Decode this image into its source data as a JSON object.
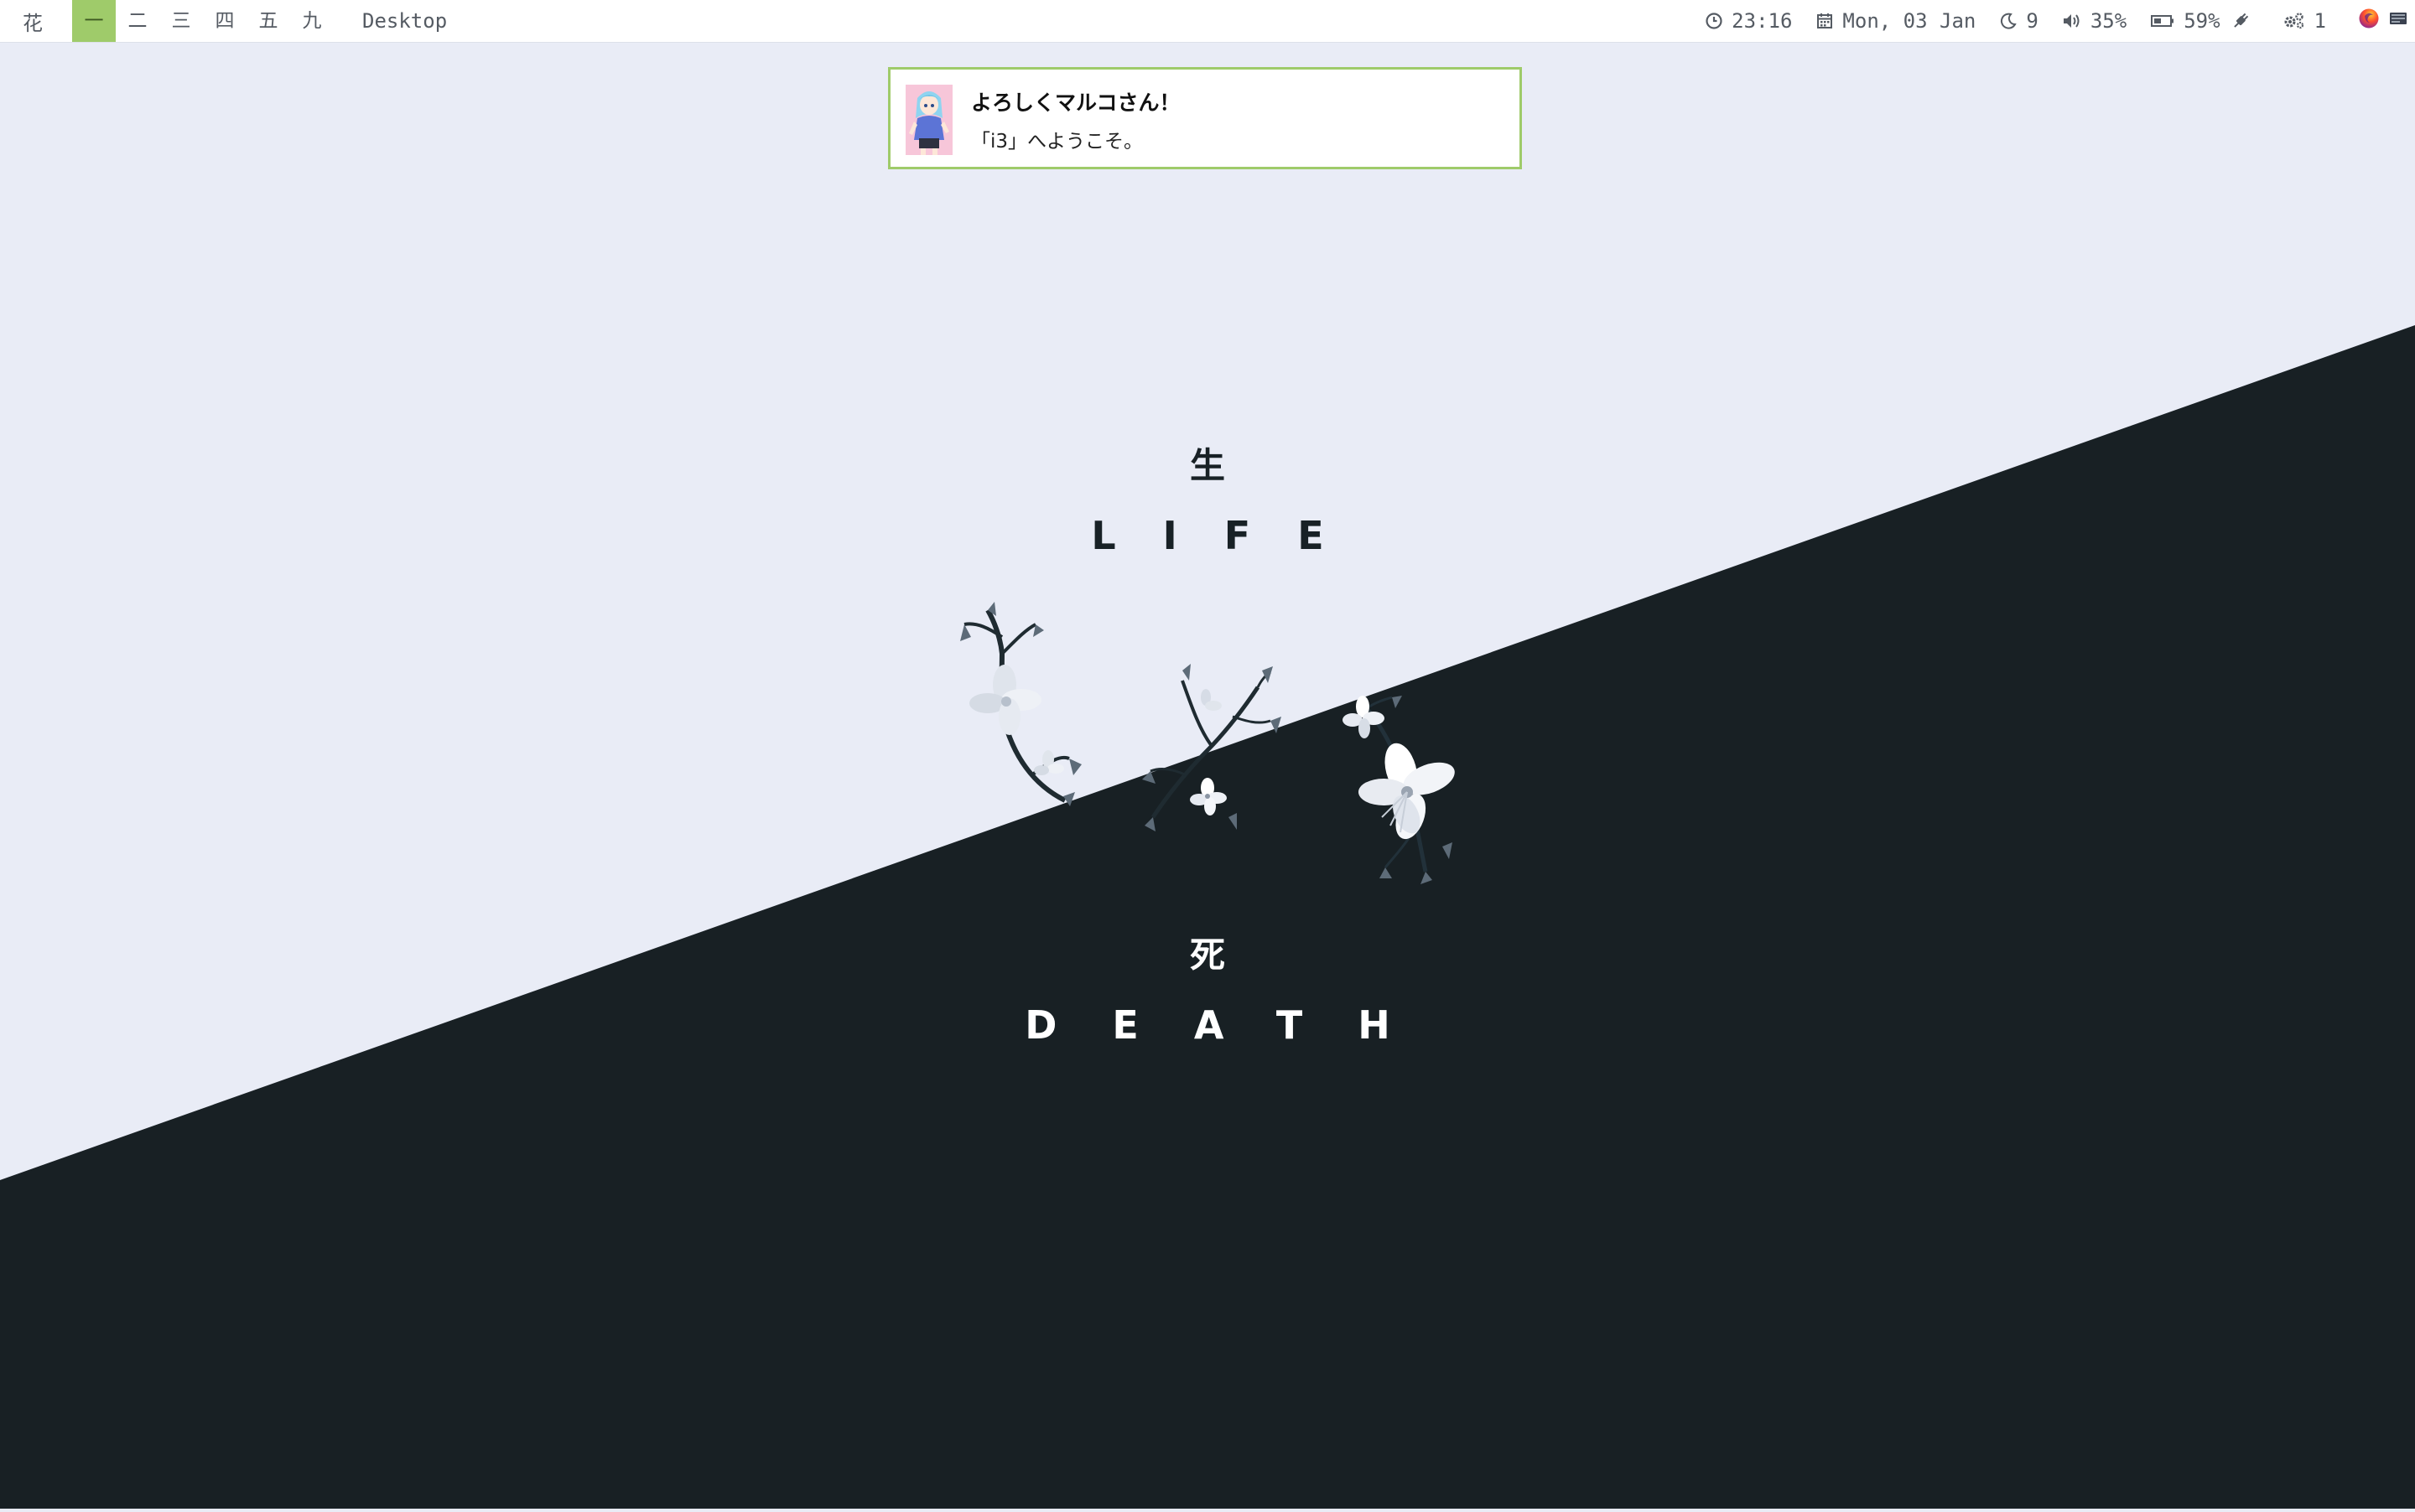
{
  "topbar": {
    "logo": "花",
    "workspaces": [
      {
        "label": "一",
        "active": true
      },
      {
        "label": "二",
        "active": false
      },
      {
        "label": "三",
        "active": false
      },
      {
        "label": "四",
        "active": false
      },
      {
        "label": "五",
        "active": false
      },
      {
        "label": "九",
        "active": false
      }
    ],
    "window_title": "Desktop",
    "modules": {
      "clock": {
        "icon": "clock-icon",
        "text": "23:16"
      },
      "date": {
        "icon": "calendar-icon",
        "text": "Mon, 03 Jan"
      },
      "night_light": {
        "icon": "moon-icon",
        "text": "9"
      },
      "volume": {
        "icon": "speaker-icon",
        "text": "35%"
      },
      "battery": {
        "icon": "battery-icon",
        "text": "59%",
        "charging_icon": "plug-icon"
      },
      "updates": {
        "icon": "gears-icon",
        "text": "1"
      }
    },
    "tray": [
      "firefox-icon",
      "terminal-icon"
    ]
  },
  "notification": {
    "title": "よろしくマルコさん！",
    "body": "「i3」へようこそ。",
    "avatar": "anime-avatar",
    "border_color": "#9fcb6a"
  },
  "wallpaper": {
    "life_kanji": "生",
    "life_word": "LIFE",
    "death_kanji": "死",
    "death_word": "DEATH",
    "light_color": "#e9ecf6",
    "dark_color": "#182024"
  },
  "colors": {
    "accent": "#9fcb6a",
    "bar_bg": "#ffffff",
    "bar_text": "#555b63"
  }
}
